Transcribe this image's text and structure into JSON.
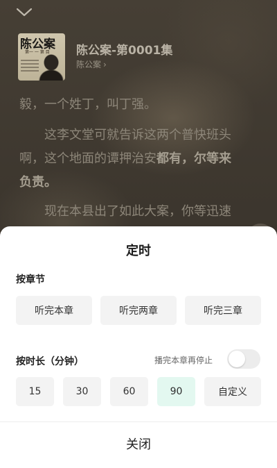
{
  "book": {
    "cover_title": "陈公案",
    "cover_subtitle": "第一 一 第 目",
    "title": "陈公案-第0001集",
    "author": "陈公案",
    "author_arrow": "›"
  },
  "reader": {
    "line1": "毅，一个姓丁，叫丁强。",
    "para2_a": "　　这李文堂可就告诉这两个普快班头",
    "para2_b": "啊，这个地面的谭押治安",
    "para2_b_bold": "都有，尔等来",
    "para2_c_bold": "负责。",
    "para3": "　　现在本县出了如此大案，你等迅速"
  },
  "sheet": {
    "title": "定时",
    "by_chapter": {
      "label": "按章节",
      "options": [
        "听完本章",
        "听完两章",
        "听完三章"
      ]
    },
    "by_duration": {
      "label": "按时长（分钟）",
      "stop_label": "播完本章再停止",
      "stop_enabled": false,
      "options": [
        "15",
        "30",
        "60",
        "90",
        "自定义"
      ],
      "selected": "90"
    },
    "close_label": "关闭"
  },
  "colors": {
    "selected_bg": "#e3f8f0",
    "option_bg": "#f3f3f3"
  }
}
